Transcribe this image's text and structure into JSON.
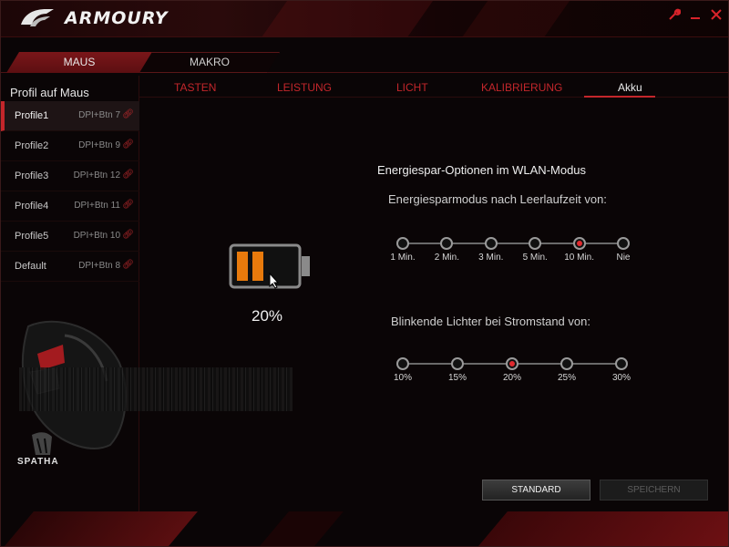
{
  "window": {
    "title": "ARMOURY",
    "controls": {
      "tools_icon": "wrench-icon",
      "minimize_icon": "minimize-icon",
      "close_icon": "close-icon"
    }
  },
  "top_tabs": [
    {
      "label": "MAUS",
      "active": true
    },
    {
      "label": "MAKRO",
      "active": false
    }
  ],
  "sidebar": {
    "title": "Profil auf Maus",
    "profiles": [
      {
        "name": "Profile1",
        "binding": "DPI+Btn 7",
        "active": true
      },
      {
        "name": "Profile2",
        "binding": "DPI+Btn 9",
        "active": false
      },
      {
        "name": "Profile3",
        "binding": "DPI+Btn 12",
        "active": false
      },
      {
        "name": "Profile4",
        "binding": "DPI+Btn 11",
        "active": false
      },
      {
        "name": "Profile5",
        "binding": "DPI+Btn 10",
        "active": false
      },
      {
        "name": "Default",
        "binding": "DPI+Btn 8",
        "active": false
      }
    ],
    "device_name": "SPATHA"
  },
  "sub_tabs": [
    {
      "label": "TASTEN",
      "active": false
    },
    {
      "label": "LEISTUNG",
      "active": false
    },
    {
      "label": "LICHT",
      "active": false
    },
    {
      "label": "KALIBRIERUNG",
      "active": false
    },
    {
      "label": "Akku",
      "active": true
    }
  ],
  "battery": {
    "percent_text": "20%",
    "level": 0.2,
    "fill_color": "#e87a0c"
  },
  "power_options": {
    "heading": "Energiespar-Optionen im WLAN-Modus",
    "idle_label": "Energiesparmodus nach Leerlaufzeit von:",
    "idle_options": [
      "1 Min.",
      "2 Min.",
      "3 Min.",
      "5 Min.",
      "10 Min.",
      "Nie"
    ],
    "idle_selected": "10 Min.",
    "blink_label": "Blinkende Lichter bei Stromstand von:",
    "blink_options": [
      "10%",
      "15%",
      "20%",
      "25%",
      "30%"
    ],
    "blink_selected": "20%"
  },
  "buttons": {
    "standard": "STANDARD",
    "save": "SPEICHERN"
  },
  "colors": {
    "accent": "#c3262b",
    "background": "#0a0506"
  }
}
